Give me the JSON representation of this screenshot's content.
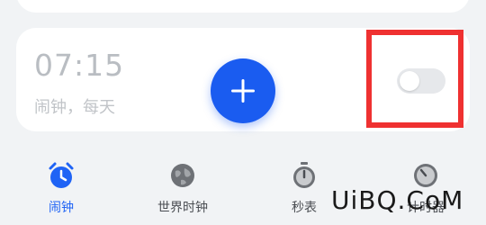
{
  "alarm": {
    "time": "07:15",
    "label": "闹钟，每天",
    "enabled": false
  },
  "fab": {
    "icon": "plus-icon"
  },
  "nav": {
    "items": [
      {
        "label": "闹钟",
        "icon": "alarm-clock-icon",
        "active": true
      },
      {
        "label": "世界时钟",
        "icon": "globe-icon",
        "active": false
      },
      {
        "label": "秒表",
        "icon": "stopwatch-icon",
        "active": false
      },
      {
        "label": "计时器",
        "icon": "timer-icon",
        "active": false
      }
    ]
  },
  "watermark": "UiBQ.CoM",
  "colors": {
    "accent": "#1f63f5",
    "fab": "#1a5cf0",
    "highlight": "#ef3131"
  }
}
